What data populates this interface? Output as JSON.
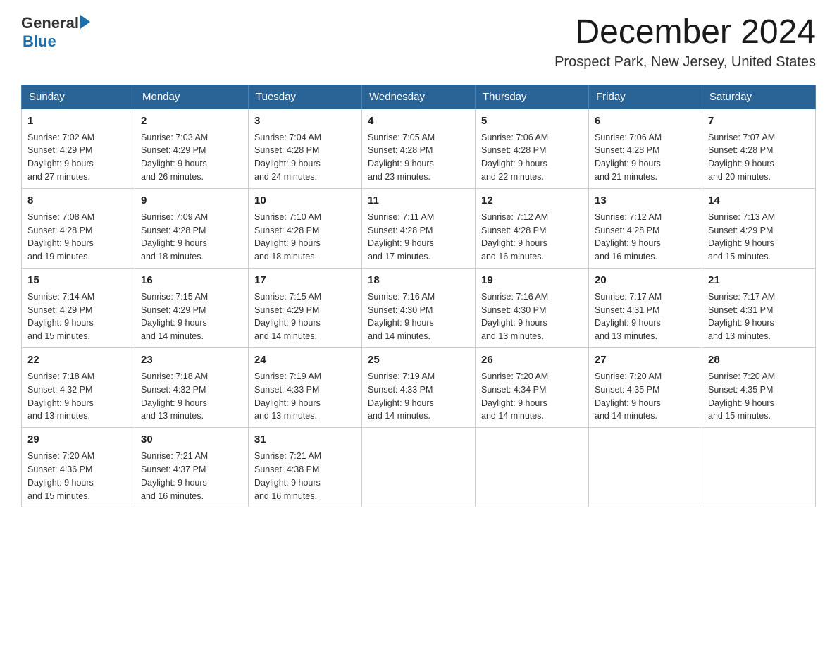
{
  "header": {
    "logo_general": "General",
    "logo_blue": "Blue",
    "month_title": "December 2024",
    "location": "Prospect Park, New Jersey, United States"
  },
  "days_of_week": [
    "Sunday",
    "Monday",
    "Tuesday",
    "Wednesday",
    "Thursday",
    "Friday",
    "Saturday"
  ],
  "weeks": [
    [
      {
        "day": "1",
        "sunrise": "7:02 AM",
        "sunset": "4:29 PM",
        "daylight": "9 hours and 27 minutes."
      },
      {
        "day": "2",
        "sunrise": "7:03 AM",
        "sunset": "4:29 PM",
        "daylight": "9 hours and 26 minutes."
      },
      {
        "day": "3",
        "sunrise": "7:04 AM",
        "sunset": "4:28 PM",
        "daylight": "9 hours and 24 minutes."
      },
      {
        "day": "4",
        "sunrise": "7:05 AM",
        "sunset": "4:28 PM",
        "daylight": "9 hours and 23 minutes."
      },
      {
        "day": "5",
        "sunrise": "7:06 AM",
        "sunset": "4:28 PM",
        "daylight": "9 hours and 22 minutes."
      },
      {
        "day": "6",
        "sunrise": "7:06 AM",
        "sunset": "4:28 PM",
        "daylight": "9 hours and 21 minutes."
      },
      {
        "day": "7",
        "sunrise": "7:07 AM",
        "sunset": "4:28 PM",
        "daylight": "9 hours and 20 minutes."
      }
    ],
    [
      {
        "day": "8",
        "sunrise": "7:08 AM",
        "sunset": "4:28 PM",
        "daylight": "9 hours and 19 minutes."
      },
      {
        "day": "9",
        "sunrise": "7:09 AM",
        "sunset": "4:28 PM",
        "daylight": "9 hours and 18 minutes."
      },
      {
        "day": "10",
        "sunrise": "7:10 AM",
        "sunset": "4:28 PM",
        "daylight": "9 hours and 18 minutes."
      },
      {
        "day": "11",
        "sunrise": "7:11 AM",
        "sunset": "4:28 PM",
        "daylight": "9 hours and 17 minutes."
      },
      {
        "day": "12",
        "sunrise": "7:12 AM",
        "sunset": "4:28 PM",
        "daylight": "9 hours and 16 minutes."
      },
      {
        "day": "13",
        "sunrise": "7:12 AM",
        "sunset": "4:28 PM",
        "daylight": "9 hours and 16 minutes."
      },
      {
        "day": "14",
        "sunrise": "7:13 AM",
        "sunset": "4:29 PM",
        "daylight": "9 hours and 15 minutes."
      }
    ],
    [
      {
        "day": "15",
        "sunrise": "7:14 AM",
        "sunset": "4:29 PM",
        "daylight": "9 hours and 15 minutes."
      },
      {
        "day": "16",
        "sunrise": "7:15 AM",
        "sunset": "4:29 PM",
        "daylight": "9 hours and 14 minutes."
      },
      {
        "day": "17",
        "sunrise": "7:15 AM",
        "sunset": "4:29 PM",
        "daylight": "9 hours and 14 minutes."
      },
      {
        "day": "18",
        "sunrise": "7:16 AM",
        "sunset": "4:30 PM",
        "daylight": "9 hours and 14 minutes."
      },
      {
        "day": "19",
        "sunrise": "7:16 AM",
        "sunset": "4:30 PM",
        "daylight": "9 hours and 13 minutes."
      },
      {
        "day": "20",
        "sunrise": "7:17 AM",
        "sunset": "4:31 PM",
        "daylight": "9 hours and 13 minutes."
      },
      {
        "day": "21",
        "sunrise": "7:17 AM",
        "sunset": "4:31 PM",
        "daylight": "9 hours and 13 minutes."
      }
    ],
    [
      {
        "day": "22",
        "sunrise": "7:18 AM",
        "sunset": "4:32 PM",
        "daylight": "9 hours and 13 minutes."
      },
      {
        "day": "23",
        "sunrise": "7:18 AM",
        "sunset": "4:32 PM",
        "daylight": "9 hours and 13 minutes."
      },
      {
        "day": "24",
        "sunrise": "7:19 AM",
        "sunset": "4:33 PM",
        "daylight": "9 hours and 13 minutes."
      },
      {
        "day": "25",
        "sunrise": "7:19 AM",
        "sunset": "4:33 PM",
        "daylight": "9 hours and 14 minutes."
      },
      {
        "day": "26",
        "sunrise": "7:20 AM",
        "sunset": "4:34 PM",
        "daylight": "9 hours and 14 minutes."
      },
      {
        "day": "27",
        "sunrise": "7:20 AM",
        "sunset": "4:35 PM",
        "daylight": "9 hours and 14 minutes."
      },
      {
        "day": "28",
        "sunrise": "7:20 AM",
        "sunset": "4:35 PM",
        "daylight": "9 hours and 15 minutes."
      }
    ],
    [
      {
        "day": "29",
        "sunrise": "7:20 AM",
        "sunset": "4:36 PM",
        "daylight": "9 hours and 15 minutes."
      },
      {
        "day": "30",
        "sunrise": "7:21 AM",
        "sunset": "4:37 PM",
        "daylight": "9 hours and 16 minutes."
      },
      {
        "day": "31",
        "sunrise": "7:21 AM",
        "sunset": "4:38 PM",
        "daylight": "9 hours and 16 minutes."
      },
      null,
      null,
      null,
      null
    ]
  ]
}
